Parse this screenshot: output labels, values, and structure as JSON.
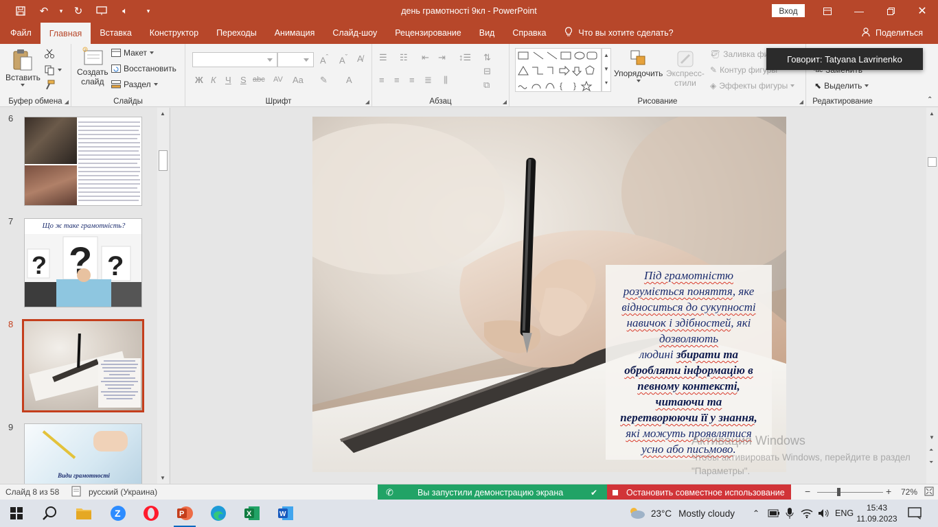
{
  "window": {
    "title": "день грамотності 9кл  -  PowerPoint",
    "signin_label": "Вход",
    "controls": [
      "restore-ribbon",
      "minimize",
      "maximize",
      "close"
    ]
  },
  "tabs": [
    {
      "label": "Файл"
    },
    {
      "label": "Главная"
    },
    {
      "label": "Вставка"
    },
    {
      "label": "Конструктор"
    },
    {
      "label": "Переходы"
    },
    {
      "label": "Анимация"
    },
    {
      "label": "Слайд-шоу"
    },
    {
      "label": "Рецензирование"
    },
    {
      "label": "Вид"
    },
    {
      "label": "Справка"
    }
  ],
  "active_tab": "Главная",
  "tell_me": "Что вы хотите сделать?",
  "share_label": "Поделиться",
  "ribbon": {
    "clipboard": {
      "paste": "Вставить",
      "group": "Буфер обмена"
    },
    "slides": {
      "new_slide_1": "Создать",
      "new_slide_2": "слайд",
      "layout": "Макет",
      "reset": "Восстановить",
      "section": "Раздел",
      "group": "Слайды"
    },
    "font": {
      "group": "Шрифт",
      "bold": "Ж",
      "italic": "К",
      "underline": "Ч",
      "strike": "S",
      "ab": "abc",
      "spacing": "AV",
      "case": "Aa",
      "color": "A"
    },
    "paragraph": {
      "group": "Абзац"
    },
    "drawing": {
      "arrange_1": "Упорядочить",
      "styles_1": "Экспресс-",
      "styles_2": "стили",
      "fill": "Заливка фи",
      "outline": "Контур фигуры",
      "effects": "Эффекты фигуры",
      "group": "Рисование"
    },
    "editing": {
      "replace": "Заменить",
      "select": "Выделить",
      "group": "Редактирование"
    }
  },
  "toast": "Говорит: Tatyana Lavrinenko",
  "thumbnails": [
    {
      "num": "6",
      "kind": "text-photos"
    },
    {
      "num": "7",
      "title": "Що ж таке грамотність?",
      "kind": "questions"
    },
    {
      "num": "8",
      "kind": "writing",
      "selected": true
    },
    {
      "num": "9",
      "caption": "Види грамотності",
      "kind": "writing2"
    }
  ],
  "slide": {
    "lines": [
      {
        "segments": [
          {
            "t": "Під грамотністю",
            "sq": true
          }
        ]
      },
      {
        "segments": [
          {
            "t": "розуміється поняття",
            "sq": true
          },
          {
            "t": ", яке",
            "sq": false
          }
        ]
      },
      {
        "segments": [
          {
            "t": "відноситься до сукупності",
            "sq": true
          }
        ]
      },
      {
        "segments": [
          {
            "t": "навичок і здібностей",
            "sq": true
          },
          {
            "t": ", які",
            "sq": false
          }
        ]
      },
      {
        "segments": [
          {
            "t": "дозволяють",
            "sq": true
          }
        ]
      },
      {
        "segments": [
          {
            "t": "людині ",
            "sq": false
          },
          {
            "t": "збирати та",
            "sq": true,
            "b": true
          }
        ]
      },
      {
        "segments": [
          {
            "t": "обробляти інформацію в",
            "sq": true,
            "b": true
          }
        ]
      },
      {
        "segments": [
          {
            "t": "певному контексті",
            "sq": true,
            "b": true
          },
          {
            "t": ",",
            "sq": false,
            "b": true
          }
        ]
      },
      {
        "segments": [
          {
            "t": "читаючи та",
            "sq": true,
            "b": true
          }
        ]
      },
      {
        "segments": [
          {
            "t": "перетворюючи її у знання",
            "sq": true,
            "b": true
          },
          {
            "t": ",",
            "sq": false,
            "b": true
          }
        ]
      },
      {
        "segments": [
          {
            "t": "які можуть проявлятися",
            "sq": true
          }
        ]
      },
      {
        "segments": [
          {
            "t": "усно або письмово",
            "sq": true
          },
          {
            "t": ".",
            "sq": false
          }
        ]
      }
    ]
  },
  "watermark": {
    "title": "Активация Windows",
    "text": "Чтобы активировать Windows, перейдите в раздел \"Параметры\"."
  },
  "status": {
    "slide_counter": "Слайд 8 из 58",
    "language": "русский (Украина)",
    "sharing": "Вы запустили демонстрацию экрана",
    "stop_sharing": "Остановить совместное использование",
    "zoom": "72%"
  },
  "taskbar": {
    "weather_temp": "23°C",
    "weather_text": "Mostly cloudy",
    "lang": "ENG",
    "time": "15:43",
    "date": "11.09.2023"
  },
  "colors": {
    "accent": "#b7472a",
    "selection": "#c43e1c",
    "share_green": "#21a366",
    "share_red": "#d13438"
  }
}
